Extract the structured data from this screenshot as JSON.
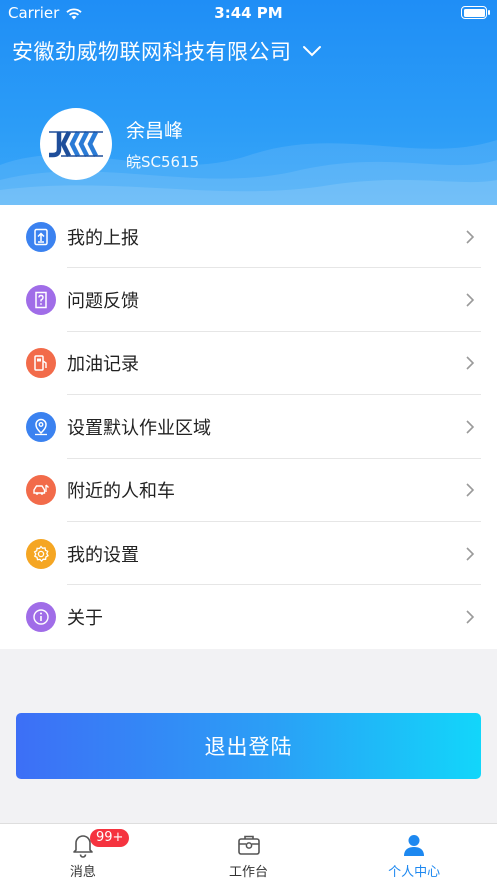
{
  "status": {
    "carrier": "Carrier",
    "time": "3:44 PM"
  },
  "header": {
    "company": "安徽劲威物联网科技有限公司"
  },
  "profile": {
    "name": "余昌峰",
    "plate": "皖SC5615"
  },
  "menu": [
    {
      "label": "我的上报",
      "icon": "report-upload-icon",
      "color": "#3b82f0"
    },
    {
      "label": "问题反馈",
      "icon": "feedback-icon",
      "color": "#a06de8"
    },
    {
      "label": "加油记录",
      "icon": "fuel-pump-icon",
      "color": "#f26b4a"
    },
    {
      "label": "设置默认作业区域",
      "icon": "location-pin-icon",
      "color": "#3b82f0"
    },
    {
      "label": "附近的人和车",
      "icon": "car-icon",
      "color": "#f26b4a"
    },
    {
      "label": "我的设置",
      "icon": "gear-icon",
      "color": "#f5a623"
    },
    {
      "label": "关于",
      "icon": "info-icon",
      "color": "#a06de8"
    }
  ],
  "logout_label": "退出登陆",
  "tabbar": {
    "messages": {
      "label": "消息",
      "badge": "99+"
    },
    "workbench": {
      "label": "工作台"
    },
    "profile": {
      "label": "个人中心"
    }
  },
  "colors": {
    "primary": "#1d88f0",
    "badge": "#f5333f"
  }
}
